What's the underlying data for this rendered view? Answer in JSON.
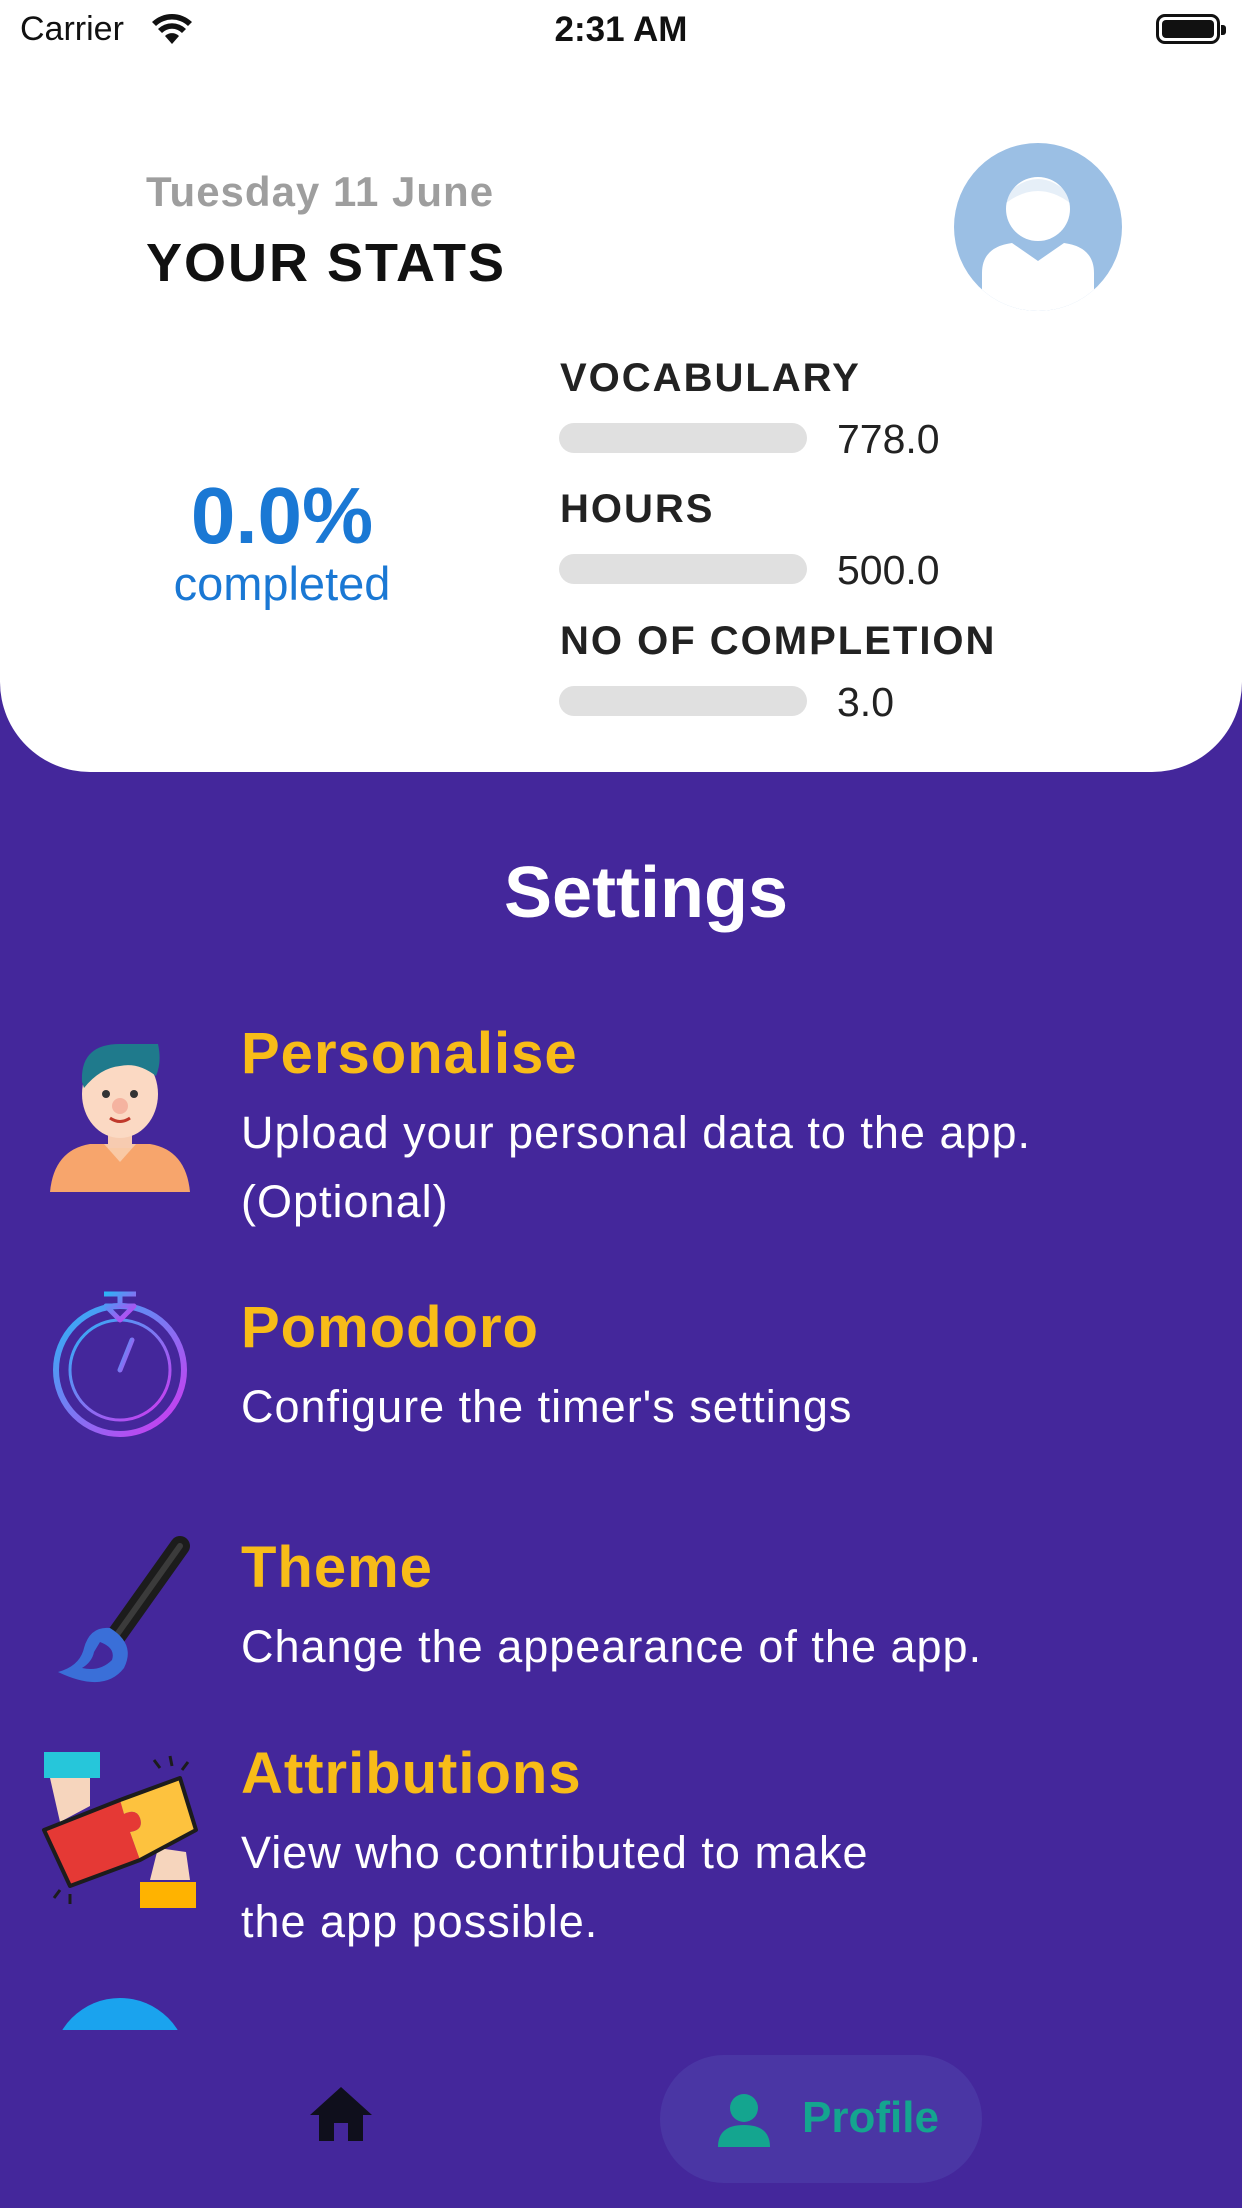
{
  "status_bar": {
    "carrier": "Carrier",
    "time": "2:31 AM"
  },
  "stats": {
    "date": "Tuesday 11 June",
    "title": "YOUR STATS",
    "percent": "0.0%",
    "percent_label": "completed",
    "items": [
      {
        "label": "VOCABULARY",
        "value": "778.0",
        "progress": 0
      },
      {
        "label": "HOURS",
        "value": "500.0",
        "progress": 0
      },
      {
        "label": "NO OF COMPLETION",
        "value": "3.0",
        "progress": 0
      }
    ]
  },
  "settings": {
    "title": "Settings",
    "items": [
      {
        "title": "Personalise",
        "desc_line1": "Upload your personal data to the app.",
        "desc_line2": "(Optional)",
        "icon": "person-icon"
      },
      {
        "title": "Pomodoro",
        "desc_line1": "Configure the timer's settings",
        "icon": "stopwatch-icon"
      },
      {
        "title": "Theme",
        "desc_line1": "Change the appearance of the app.",
        "icon": "brush-icon"
      },
      {
        "title": "Attributions",
        "desc_line1": "View who contributed to make",
        "desc_line2": "the app possible.",
        "icon": "puzzle-icon"
      }
    ]
  },
  "tabs": {
    "home_icon": "home-icon",
    "profile_label": "Profile",
    "profile_icon": "person-icon"
  },
  "colors": {
    "background": "#44279b",
    "accent_title": "#f8bc18",
    "stat_blue": "#1a78d4",
    "profile_active": "#14a58f"
  }
}
